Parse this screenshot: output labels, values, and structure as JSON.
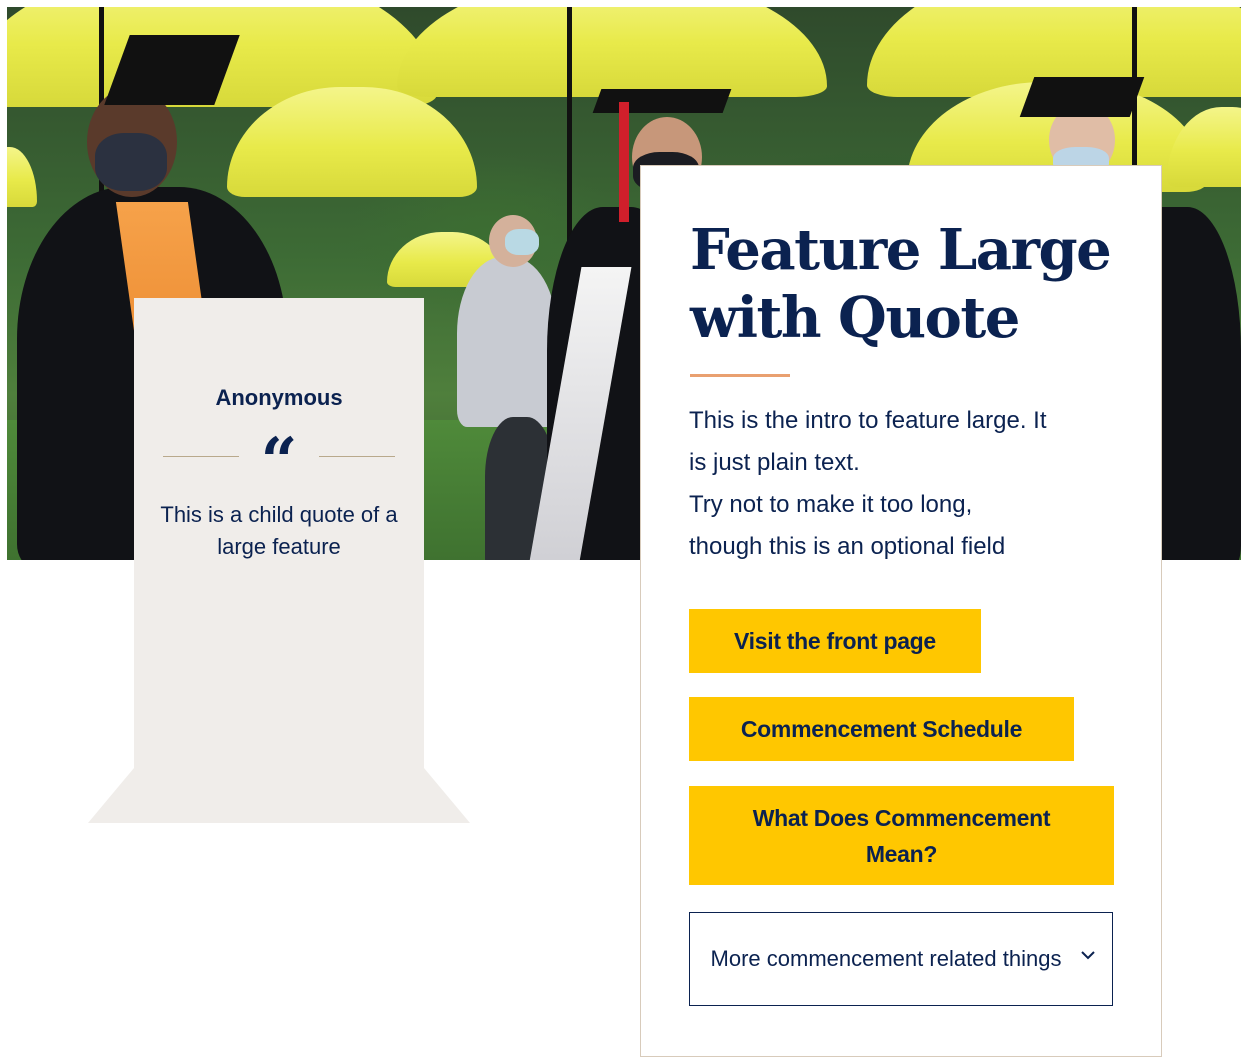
{
  "quote": {
    "author": "Anonymous",
    "mark": "“",
    "text": "This is a child quote of a large feature"
  },
  "feature": {
    "title": "Feature Large with Quote",
    "intro_lines": [
      "This is the intro to feature large. It",
      "is just plain text.",
      "Try not to make it too long,",
      "though this is an optional field"
    ],
    "buttons": [
      {
        "label": "Visit the front page"
      },
      {
        "label": "Commencement Schedule"
      },
      {
        "label": "What Does Commencement Mean?"
      }
    ],
    "dropdown": {
      "label": "More commencement related things",
      "icon": "chevron-down-icon"
    }
  },
  "hero_image": {
    "icon": "photo-graduates-yellow-umbrellas"
  },
  "colors": {
    "navy": "#0b2250",
    "gold_button": "#ffc700",
    "accent_line": "#e9a070",
    "quote_bg": "#f0edea"
  }
}
